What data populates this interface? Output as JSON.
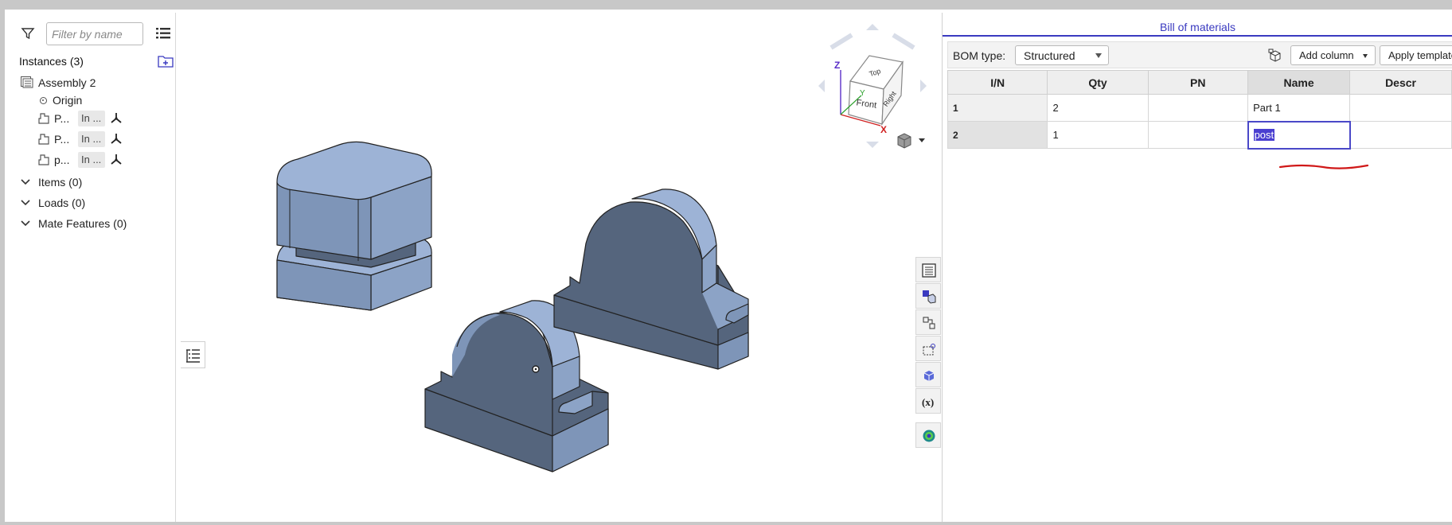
{
  "left_panel": {
    "filter_placeholder": "Filter by name",
    "instances_label": "Instances (3)",
    "tree": [
      {
        "label": "Assembly 2"
      },
      {
        "label": "Origin"
      },
      {
        "label": "P...",
        "tag": "In ..."
      },
      {
        "label": "P...",
        "tag": "In ..."
      },
      {
        "label": "p...",
        "tag": "In ..."
      }
    ],
    "sections": [
      {
        "label": "Items (0)"
      },
      {
        "label": "Loads (0)"
      },
      {
        "label": "Mate Features (0)"
      }
    ]
  },
  "view_cube": {
    "faces": {
      "top": "Top",
      "front": "Front",
      "right": "Right"
    },
    "axes": {
      "z": "Z",
      "x": "X",
      "y": "Y"
    },
    "colors": {
      "z": "#5a2fc8",
      "x": "#d02020",
      "y": "#2aa02a"
    }
  },
  "bom": {
    "title": "Bill of materials",
    "type_label": "BOM type:",
    "type_value": "Structured",
    "add_column_label": "Add column",
    "apply_template_label": "Apply template",
    "columns": [
      "I/N",
      "Qty",
      "PN",
      "Name",
      "Descr"
    ],
    "rows": [
      {
        "in": "1",
        "qty": "2",
        "pn": "",
        "name": "Part 1",
        "descr": ""
      },
      {
        "in": "2",
        "qty": "1",
        "pn": "",
        "name": "post",
        "descr": ""
      }
    ],
    "accent_color": "#3a3ac0"
  },
  "model_colors": {
    "top": "#9db3d6",
    "side": "#7e95b8",
    "dark": "#55657d"
  }
}
